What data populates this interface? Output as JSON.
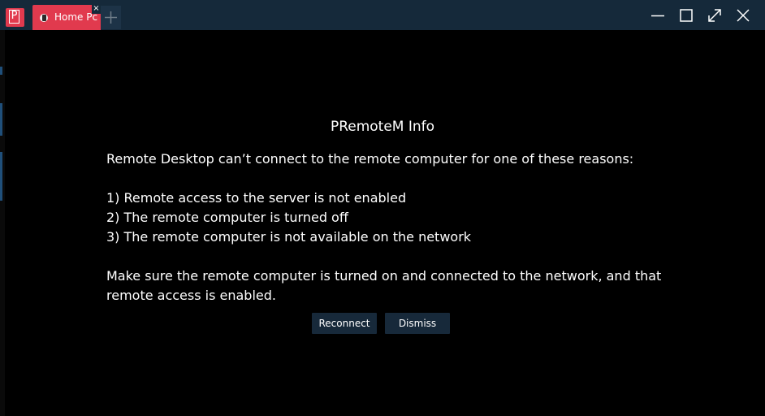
{
  "window": {
    "tab_label": "Home Pc",
    "tab_close_symbol": "×",
    "app_icon_letter": "P",
    "icons": {
      "app": "premotem-app-icon",
      "tab": "remote-pc-icon",
      "new_tab": "plus-icon",
      "minimize": "minimize-icon",
      "maximize": "maximize-icon",
      "fullscreen": "fullscreen-icon",
      "close": "close-icon"
    },
    "colors": {
      "titlebar": "#15293a",
      "tab_accent": "#e13a4e",
      "content_bg": "#000000",
      "button_bg": "#17293a"
    }
  },
  "dialog": {
    "title": "PRemoteM Info",
    "intro": "Remote Desktop can’t connect to the remote computer for one of these reasons:",
    "reasons": [
      "1) Remote access to the server is not enabled",
      "2) The remote computer is turned off",
      "3) The remote computer is not available on the network"
    ],
    "advice_line_1": "Make sure the remote computer is turned on and connected to the network, and that",
    "advice_line_2": "remote access is enabled.",
    "reconnect_label": "Reconnect",
    "dismiss_label": "Dismiss"
  }
}
